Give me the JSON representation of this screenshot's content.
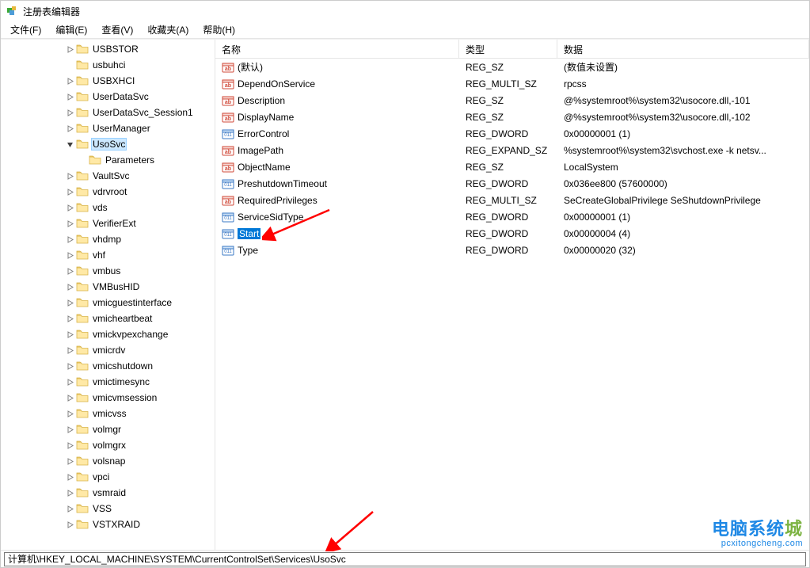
{
  "window": {
    "title": "注册表编辑器"
  },
  "menu": {
    "file": "文件(F)",
    "edit": "编辑(E)",
    "view": "查看(V)",
    "favorites": "收藏夹(A)",
    "help": "帮助(H)"
  },
  "tree": {
    "items": [
      {
        "depth": 5,
        "name": "USBSTOR",
        "expander": "closed"
      },
      {
        "depth": 5,
        "name": "usbuhci",
        "expander": "none"
      },
      {
        "depth": 5,
        "name": "USBXHCI",
        "expander": "closed"
      },
      {
        "depth": 5,
        "name": "UserDataSvc",
        "expander": "closed"
      },
      {
        "depth": 5,
        "name": "UserDataSvc_Session1",
        "expander": "closed"
      },
      {
        "depth": 5,
        "name": "UserManager",
        "expander": "closed"
      },
      {
        "depth": 5,
        "name": "UsoSvc",
        "expander": "open",
        "selected": true
      },
      {
        "depth": 6,
        "name": "Parameters",
        "expander": "none"
      },
      {
        "depth": 5,
        "name": "VaultSvc",
        "expander": "closed"
      },
      {
        "depth": 5,
        "name": "vdrvroot",
        "expander": "closed"
      },
      {
        "depth": 5,
        "name": "vds",
        "expander": "closed"
      },
      {
        "depth": 5,
        "name": "VerifierExt",
        "expander": "closed"
      },
      {
        "depth": 5,
        "name": "vhdmp",
        "expander": "closed"
      },
      {
        "depth": 5,
        "name": "vhf",
        "expander": "closed"
      },
      {
        "depth": 5,
        "name": "vmbus",
        "expander": "closed"
      },
      {
        "depth": 5,
        "name": "VMBusHID",
        "expander": "closed"
      },
      {
        "depth": 5,
        "name": "vmicguestinterface",
        "expander": "closed"
      },
      {
        "depth": 5,
        "name": "vmicheartbeat",
        "expander": "closed"
      },
      {
        "depth": 5,
        "name": "vmickvpexchange",
        "expander": "closed"
      },
      {
        "depth": 5,
        "name": "vmicrdv",
        "expander": "closed"
      },
      {
        "depth": 5,
        "name": "vmicshutdown",
        "expander": "closed"
      },
      {
        "depth": 5,
        "name": "vmictimesync",
        "expander": "closed"
      },
      {
        "depth": 5,
        "name": "vmicvmsession",
        "expander": "closed"
      },
      {
        "depth": 5,
        "name": "vmicvss",
        "expander": "closed"
      },
      {
        "depth": 5,
        "name": "volmgr",
        "expander": "closed"
      },
      {
        "depth": 5,
        "name": "volmgrx",
        "expander": "closed"
      },
      {
        "depth": 5,
        "name": "volsnap",
        "expander": "closed"
      },
      {
        "depth": 5,
        "name": "vpci",
        "expander": "closed"
      },
      {
        "depth": 5,
        "name": "vsmraid",
        "expander": "closed"
      },
      {
        "depth": 5,
        "name": "VSS",
        "expander": "closed"
      },
      {
        "depth": 5,
        "name": "VSTXRAID",
        "expander": "closed"
      }
    ]
  },
  "columns": {
    "name": "名称",
    "type": "类型",
    "data": "数据"
  },
  "values": [
    {
      "icon": "str",
      "name": "(默认)",
      "type": "REG_SZ",
      "data": "(数值未设置)"
    },
    {
      "icon": "str",
      "name": "DependOnService",
      "type": "REG_MULTI_SZ",
      "data": "rpcss"
    },
    {
      "icon": "str",
      "name": "Description",
      "type": "REG_SZ",
      "data": "@%systemroot%\\system32\\usocore.dll,-101"
    },
    {
      "icon": "str",
      "name": "DisplayName",
      "type": "REG_SZ",
      "data": "@%systemroot%\\system32\\usocore.dll,-102"
    },
    {
      "icon": "bin",
      "name": "ErrorControl",
      "type": "REG_DWORD",
      "data": "0x00000001 (1)"
    },
    {
      "icon": "str",
      "name": "ImagePath",
      "type": "REG_EXPAND_SZ",
      "data": "%systemroot%\\system32\\svchost.exe -k netsv..."
    },
    {
      "icon": "str",
      "name": "ObjectName",
      "type": "REG_SZ",
      "data": "LocalSystem"
    },
    {
      "icon": "bin",
      "name": "PreshutdownTimeout",
      "type": "REG_DWORD",
      "data": "0x036ee800 (57600000)"
    },
    {
      "icon": "str",
      "name": "RequiredPrivileges",
      "type": "REG_MULTI_SZ",
      "data": "SeCreateGlobalPrivilege SeShutdownPrivilege"
    },
    {
      "icon": "bin",
      "name": "ServiceSidType",
      "type": "REG_DWORD",
      "data": "0x00000001 (1)"
    },
    {
      "icon": "bin",
      "name": "Start",
      "type": "REG_DWORD",
      "data": "0x00000004 (4)",
      "selected": true
    },
    {
      "icon": "bin",
      "name": "Type",
      "type": "REG_DWORD",
      "data": "0x00000020 (32)"
    }
  ],
  "status": {
    "path": "计算机\\HKEY_LOCAL_MACHINE\\SYSTEM\\CurrentControlSet\\Services\\UsoSvc"
  },
  "watermark": {
    "cn1": "电脑系统",
    "cn2": "城",
    "en": "pcxitongcheng.com"
  }
}
